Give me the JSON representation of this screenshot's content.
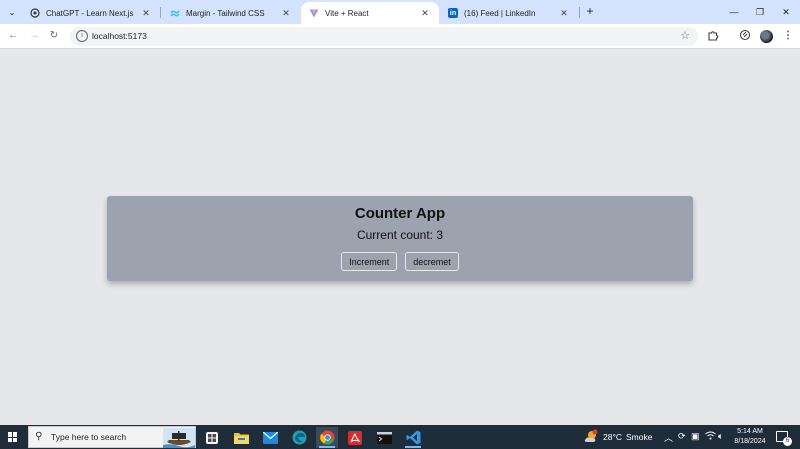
{
  "browser": {
    "tabs": [
      {
        "title": "ChatGPT - Learn Next.js",
        "active": false
      },
      {
        "title": "Margin - Tailwind CSS",
        "active": false
      },
      {
        "title": "Vite + React",
        "active": true
      },
      {
        "title": "(16) Feed | LinkedIn",
        "active": false
      }
    ],
    "address": "localhost:5173"
  },
  "app": {
    "title": "Counter App",
    "count_label": "Current count: 3",
    "count": 3,
    "increment_label": "Increment",
    "decrement_label": "decremet"
  },
  "taskbar": {
    "search_placeholder": "Type here to search",
    "weather_temp": "28°C",
    "weather_desc": "Smoke",
    "time": "5:14 AM",
    "date": "8/18/2024",
    "notification_count": "6"
  },
  "colors": {
    "page_background": "#e5e7eb",
    "card_background": "#9ca3af",
    "tabstrip": "#d3e3fd",
    "taskbar": "#1f2d3a"
  }
}
